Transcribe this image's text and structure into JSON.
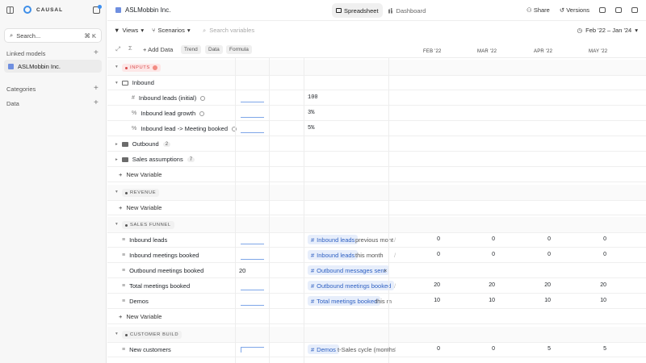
{
  "brand": "CAUSAL",
  "sidebar": {
    "search_placeholder": "Search...",
    "search_shortcut": "⌘ K",
    "linked_models_title": "Linked models",
    "linked_model": "ASLMobbin Inc.",
    "categories_title": "Categories",
    "data_title": "Data"
  },
  "topbar": {
    "model_name": "ASLMobbin Inc.",
    "tabs": [
      "Spreadsheet",
      "Dashboard"
    ],
    "share": "Share",
    "versions": "Versions"
  },
  "toolbar": {
    "views": "Views",
    "scenarios": "Scenarios",
    "search_placeholder": "Search variables",
    "date_range": "Feb '22 – Jan '24"
  },
  "columns": {
    "add_data": "Add Data",
    "pills": [
      "Trend",
      "Data",
      "Formula"
    ],
    "months": [
      "FEB '22",
      "MAR '22",
      "APR '22",
      "MAY '22"
    ]
  },
  "sections": {
    "inputs": "INPUTS",
    "revenue": "REVENUE",
    "sales_funnel": "SALES FUNNEL",
    "customer_build": "CUSTOMER BUILD"
  },
  "inputs": {
    "inbound_group": "Inbound",
    "rows": [
      {
        "name": "Inbound leads (initial)",
        "value": "100"
      },
      {
        "name": "Inbound lead growth",
        "value": "3%"
      },
      {
        "name": "Inbound lead -> Meeting booked",
        "value": "5%"
      }
    ],
    "outbound": "Outbound",
    "outbound_count": "2",
    "sales_assumptions": "Sales assumptions",
    "sales_count": "7"
  },
  "new_variable": "New Variable",
  "funnel_rows": [
    {
      "name": "Inbound leads",
      "tag": "Inbound leads",
      "after": "previous mont",
      "values": [
        "0",
        "0",
        "0",
        "0"
      ]
    },
    {
      "name": "Inbound meetings booked",
      "tag": "Inbound leads",
      "after": "this month",
      "values": [
        "0",
        "0",
        "0",
        "0"
      ]
    },
    {
      "name": "Outbound meetings booked",
      "value": "20",
      "tag": "Outbound messages sent",
      "after": "×",
      "values": []
    },
    {
      "name": "Total meetings booked",
      "tag": "Outbound meetings booked",
      "after": "",
      "values": [
        "20",
        "20",
        "20",
        "20"
      ]
    },
    {
      "name": "Demos",
      "tag": "Total meetings booked",
      "after": "this m",
      "values": [
        "10",
        "10",
        "10",
        "10"
      ]
    }
  ],
  "customer_rows": [
    {
      "name": "New customers",
      "tag": "Demos",
      "after": "t-Sales cycle (months",
      "values": [
        "0",
        "0",
        "5",
        "5"
      ]
    }
  ],
  "colors": {
    "accent": "#3b8ef0",
    "tag_bg": "#e7eefb",
    "tag_text": "#2d5fc2",
    "warn": "#d94a4a"
  }
}
